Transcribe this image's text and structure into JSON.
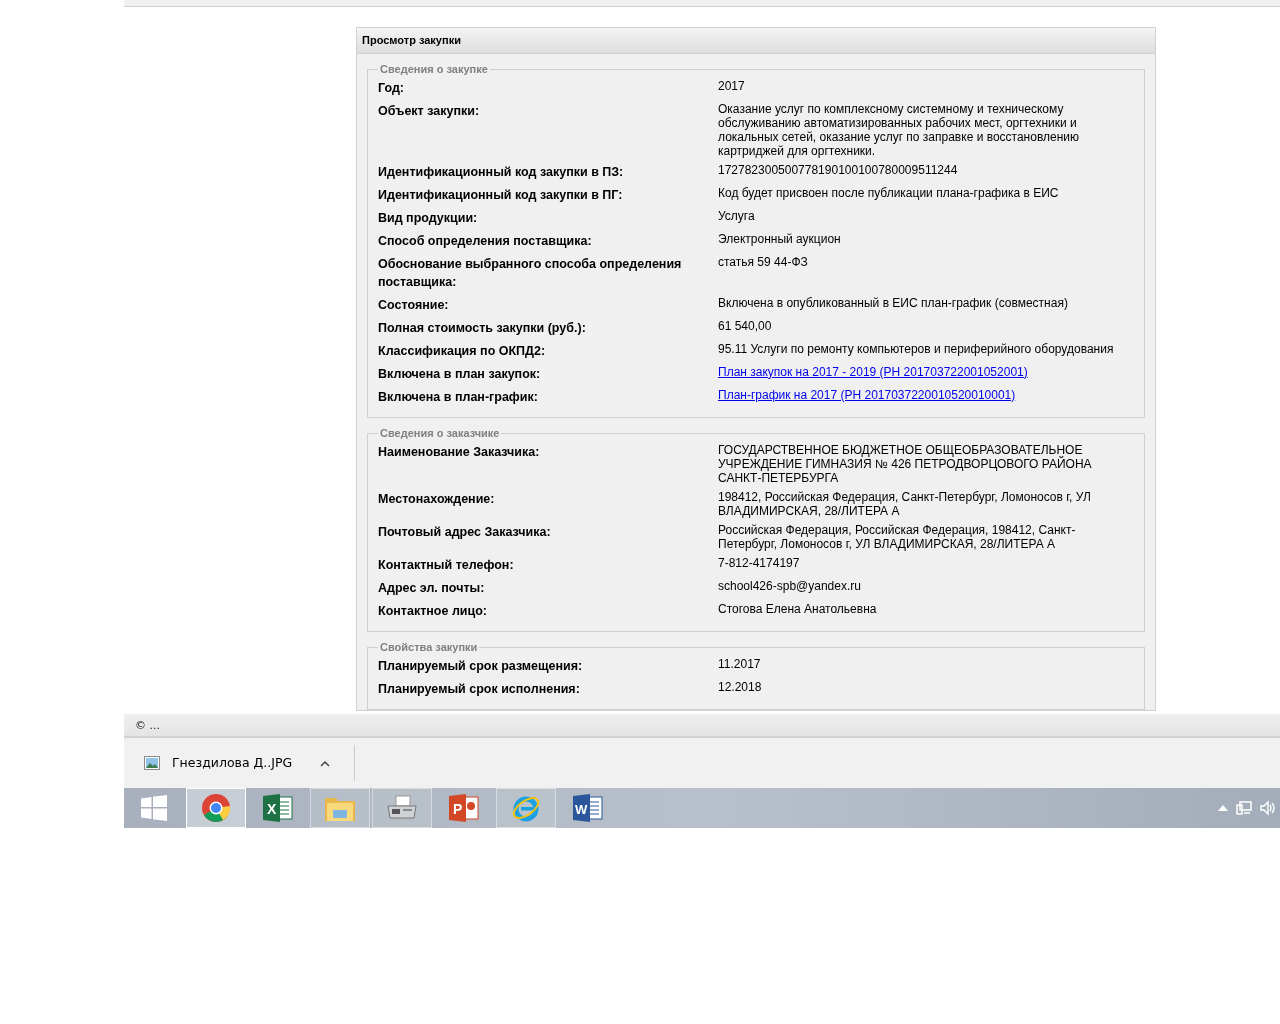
{
  "panel": {
    "title": "Просмотр закупки",
    "sections": [
      {
        "legend": "Сведения о закупке",
        "fields": [
          {
            "label": "Год:",
            "value": "2017",
            "link": false
          },
          {
            "label": "Объект закупки:",
            "value": "Оказание услуг по комплексному системному и техническому обслуживанию автоматизированных рабочих мест, оргтехники и локальных сетей, оказание услуг по заправке и восстановлению картриджей для оргтехники.",
            "link": false
          },
          {
            "label": "Идентификационный код закупки в ПЗ:",
            "value": "172782300500778190100100780009511244",
            "link": false
          },
          {
            "label": "Идентификационный код закупки в ПГ:",
            "value": "Код будет присвоен после публикации плана-графика в ЕИС",
            "link": false
          },
          {
            "label": "Вид продукции:",
            "value": "Услуга",
            "link": false
          },
          {
            "label": "Способ определения поставщика:",
            "value": "Электронный аукцион",
            "link": false
          },
          {
            "label": "Обоснование выбранного способа определения поставщика:",
            "value": "статья 59 44-ФЗ",
            "link": false
          },
          {
            "label": "Состояние:",
            "value": "Включена в опубликованный в ЕИС план-график (совместная)",
            "link": false
          },
          {
            "label": "Полная стоимость закупки (руб.):",
            "value": "61 540,00",
            "link": false
          },
          {
            "label": "Классификация по ОКПД2:",
            "value": "95.11 Услуги по ремонту компьютеров и периферийного оборудования",
            "link": false
          },
          {
            "label": "Включена в план закупок:",
            "value": "План закупок на 2017 - 2019 (РН 201703722001052001)",
            "link": true
          },
          {
            "label": "Включена в план-график:",
            "value": "План-график на 2017 (РН 2017037220010520010001)",
            "link": true
          }
        ]
      },
      {
        "legend": "Сведения о заказчике",
        "fields": [
          {
            "label": "Наименование Заказчика:",
            "value": "ГОСУДАРСТВЕННОЕ БЮДЖЕТНОЕ ОБЩЕОБРАЗОВАТЕЛЬНОЕ УЧРЕЖДЕНИЕ ГИМНАЗИЯ № 426 ПЕТРОДВОРЦОВОГО РАЙОНА САНКТ-ПЕТЕРБУРГА",
            "link": false
          },
          {
            "label": "Местонахождение:",
            "value": "198412, Российская Федерация, Санкт-Петербург, Ломоносов г, УЛ ВЛАДИМИРСКАЯ, 28/ЛИТЕРА А",
            "link": false
          },
          {
            "label": "Почтовый адрес Заказчика:",
            "value": "Российская Федерация, Российская Федерация, 198412, Санкт-Петербург, Ломоносов г, УЛ ВЛАДИМИРСКАЯ, 28/ЛИТЕРА А",
            "link": false
          },
          {
            "label": "Контактный телефон:",
            "value": "7-812-4174197",
            "link": false
          },
          {
            "label": "Адрес эл. почты:",
            "value": "school426-spb@yandex.ru",
            "link": false
          },
          {
            "label": "Контактное лицо:",
            "value": "Стогова Елена Анатольевна",
            "link": false
          }
        ]
      },
      {
        "legend": "Свойства закупки",
        "fields": [
          {
            "label": "Планируемый срок размещения:",
            "value": "11.2017",
            "link": false
          },
          {
            "label": "Планируемый срок исполнения:",
            "value": "12.2018",
            "link": false
          }
        ]
      }
    ]
  },
  "status_bar": {
    "text": "© ..."
  },
  "downloads": [
    {
      "file": "Гнездилова Д..JPG"
    }
  ],
  "taskbar": {
    "apps": [
      {
        "kind": "start",
        "selected": false,
        "running": false
      },
      {
        "kind": "chrome",
        "selected": true,
        "running": true
      },
      {
        "kind": "excel",
        "selected": false,
        "running": false,
        "letter": "X"
      },
      {
        "kind": "explorer",
        "selected": false,
        "running": true
      },
      {
        "kind": "fax",
        "selected": false,
        "running": true
      },
      {
        "kind": "powerpoint",
        "selected": false,
        "running": false,
        "letter": "P"
      },
      {
        "kind": "ie",
        "selected": false,
        "running": true
      },
      {
        "kind": "word",
        "selected": false,
        "running": false,
        "letter": "W"
      }
    ]
  }
}
